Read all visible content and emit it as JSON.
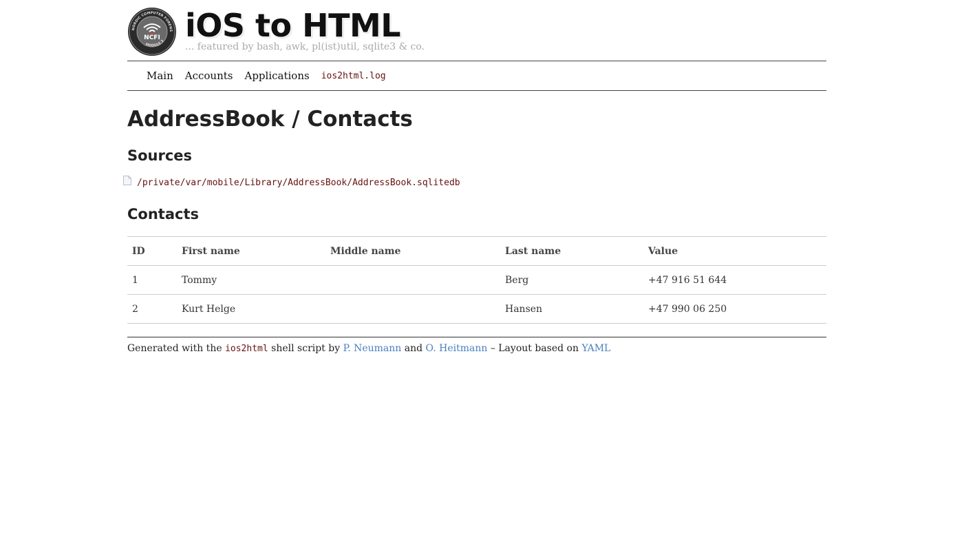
{
  "header": {
    "title": "iOS to HTML",
    "tagline": "... featured by bash, awk, pl(ist)util, sqlite3 & co.",
    "logo": {
      "text": "NCFI",
      "ring_text": "NORDIC COMPUTER FORENSIC INVESTIGATORS",
      "bottom_text": "MODULE 3"
    }
  },
  "nav": {
    "items": [
      {
        "label": "Main"
      },
      {
        "label": "Accounts"
      },
      {
        "label": "Applications"
      },
      {
        "label": "ios2html.log"
      }
    ]
  },
  "main": {
    "title": "AddressBook / Contacts",
    "sources_heading": "Sources",
    "source_path": "/private/var/mobile/Library/AddressBook/AddressBook.sqlitedb",
    "contacts_heading": "Contacts",
    "table": {
      "headers": [
        "ID",
        "First name",
        "Middle name",
        "Last name",
        "Value"
      ],
      "rows": [
        [
          "1",
          "Tommy",
          "",
          "Berg",
          "+47 916 51 644"
        ],
        [
          "2",
          "Kurt Helge",
          "",
          "Hansen",
          "+47 990 06 250"
        ]
      ]
    }
  },
  "footer": {
    "prefix": "Generated with the",
    "script": "ios2html",
    "middle": "shell script by",
    "author1": "P. Neumann",
    "and": "and",
    "author2": "O. Heitmann",
    "layout_prefix": "– Layout based on",
    "layout_link": "YAML",
    "link_color": "#4a7fbf"
  },
  "colors": {
    "code_text": "#661111",
    "tagline": "#aaaaaa"
  }
}
